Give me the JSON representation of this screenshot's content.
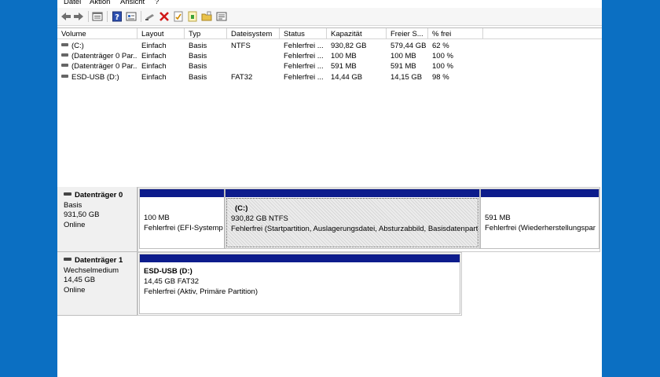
{
  "menu": [
    "Datei",
    "Aktion",
    "Ansicht",
    "?"
  ],
  "toolbar": {
    "icons": [
      "back-arrow-icon",
      "forward-arrow-icon",
      "list-view-icon",
      "help-icon",
      "properties-icon",
      "connect-icon",
      "delete-icon",
      "checklist-icon",
      "new-document-icon",
      "folder-icon",
      "window-icon"
    ]
  },
  "columns": [
    "Volume",
    "Layout",
    "Typ",
    "Dateisystem",
    "Status",
    "Kapazität",
    "Freier S...",
    "% frei"
  ],
  "volumes": [
    {
      "volume": "(C:)",
      "layout": "Einfach",
      "typ": "Basis",
      "fs": "NTFS",
      "status": "Fehlerfrei ...",
      "kap": "930,82 GB",
      "frei": "579,44 GB",
      "pct": "62 %"
    },
    {
      "volume": "(Datenträger 0 Par...",
      "layout": "Einfach",
      "typ": "Basis",
      "fs": "",
      "status": "Fehlerfrei ...",
      "kap": "100 MB",
      "frei": "100 MB",
      "pct": "100 %"
    },
    {
      "volume": "(Datenträger 0 Par...",
      "layout": "Einfach",
      "typ": "Basis",
      "fs": "",
      "status": "Fehlerfrei ...",
      "kap": "591 MB",
      "frei": "591 MB",
      "pct": "100 %"
    },
    {
      "volume": "ESD-USB (D:)",
      "layout": "Einfach",
      "typ": "Basis",
      "fs": "FAT32",
      "status": "Fehlerfrei ...",
      "kap": "14,44 GB",
      "frei": "14,15 GB",
      "pct": "98 %"
    }
  ],
  "disks": [
    {
      "name": "Datenträger 0",
      "type": "Basis",
      "size": "931,50 GB",
      "state": "Online",
      "partitions": [
        {
          "title": "",
          "size": "100 MB",
          "status": "Fehlerfrei (EFI-Systemp"
        },
        {
          "title": "(C:)",
          "size": "930,82 GB NTFS",
          "status": "Fehlerfrei (Startpartition, Auslagerungsdatei, Absturzabbild, Basisdatenparti"
        },
        {
          "title": "",
          "size": "591 MB",
          "status": "Fehlerfrei (Wiederherstellungspar"
        }
      ]
    },
    {
      "name": "Datenträger 1",
      "type": "Wechselmedium",
      "size": "14,45 GB",
      "state": "Online",
      "partitions": [
        {
          "title": "ESD-USB  (D:)",
          "size": "14,45 GB FAT32",
          "status": "Fehlerfrei (Aktiv, Primäre Partition)"
        }
      ]
    }
  ],
  "colors": {
    "partition_bar": "#0d1c8c",
    "desktop": "#0b6fc2"
  }
}
